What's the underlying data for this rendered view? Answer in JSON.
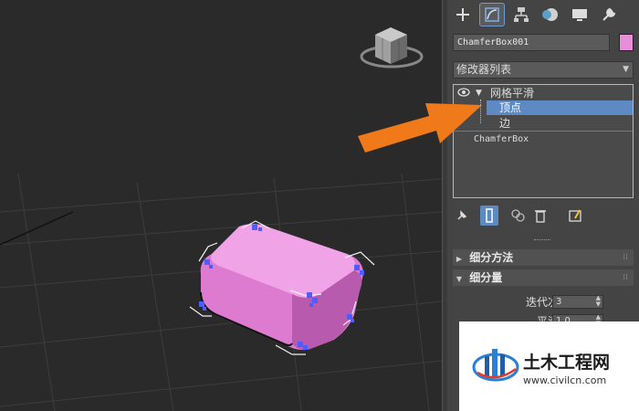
{
  "viewport": {
    "object_color": "#e07fd3",
    "selection_color": "#4f5cff"
  },
  "command_panel": {
    "tabs": [
      {
        "icon": "plus-icon",
        "label": "Create"
      },
      {
        "icon": "curve-icon",
        "label": "Modify"
      },
      {
        "icon": "hierarchy-icon",
        "label": "Hierarchy"
      },
      {
        "icon": "motion-icon",
        "label": "Motion"
      },
      {
        "icon": "display-icon",
        "label": "Display"
      },
      {
        "icon": "wrench-icon",
        "label": "Utilities"
      }
    ],
    "active_tab": "Modify",
    "object_name": "ChamferBox001",
    "object_color": "#e68fd8",
    "modifier_list_label": "修改器列表",
    "stack": {
      "modifier": "网格平滑",
      "sub_items": [
        "顶点",
        "边"
      ],
      "selected_sub": "顶点",
      "base_object": "ChamferBox"
    },
    "rollouts": {
      "subdivision_method": "细分方法",
      "subdivision_amount": "细分量"
    },
    "params": {
      "iterations_label": "迭代次数:",
      "iterations_value": "3",
      "smoothness_label": "平滑度:",
      "smoothness_value": "1.0"
    }
  },
  "watermark": {
    "title": "土木工程网",
    "url": "www.civilcn.com"
  },
  "accent": {
    "arrow": "#f07a1a",
    "selection_highlight": "#5e8ac3"
  }
}
